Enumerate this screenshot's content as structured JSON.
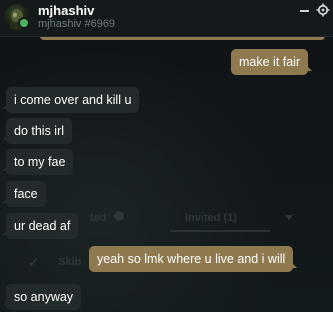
{
  "header": {
    "username": "mjhashiv",
    "tag": "mjhashiv #6969",
    "status_color": "#4ab35e"
  },
  "background": {
    "tab_left": "ted",
    "tab_right": "Invited (1)",
    "row_text": "Skib"
  },
  "colors": {
    "outgoing_bubble": "#8f7a4f",
    "incoming_bubble": "#232a2c",
    "background": "#0f1315"
  },
  "messages": [
    {
      "direction": "out",
      "text": "make it fair"
    },
    {
      "direction": "in",
      "text": "i come over and kill u"
    },
    {
      "direction": "in",
      "text": "do this irl"
    },
    {
      "direction": "in",
      "text": "to my fae"
    },
    {
      "direction": "in",
      "text": "face"
    },
    {
      "direction": "in",
      "text": "ur dead af"
    },
    {
      "direction": "out",
      "text": "yeah so lmk where u live and i will"
    },
    {
      "direction": "in",
      "text": "so anyway"
    }
  ]
}
